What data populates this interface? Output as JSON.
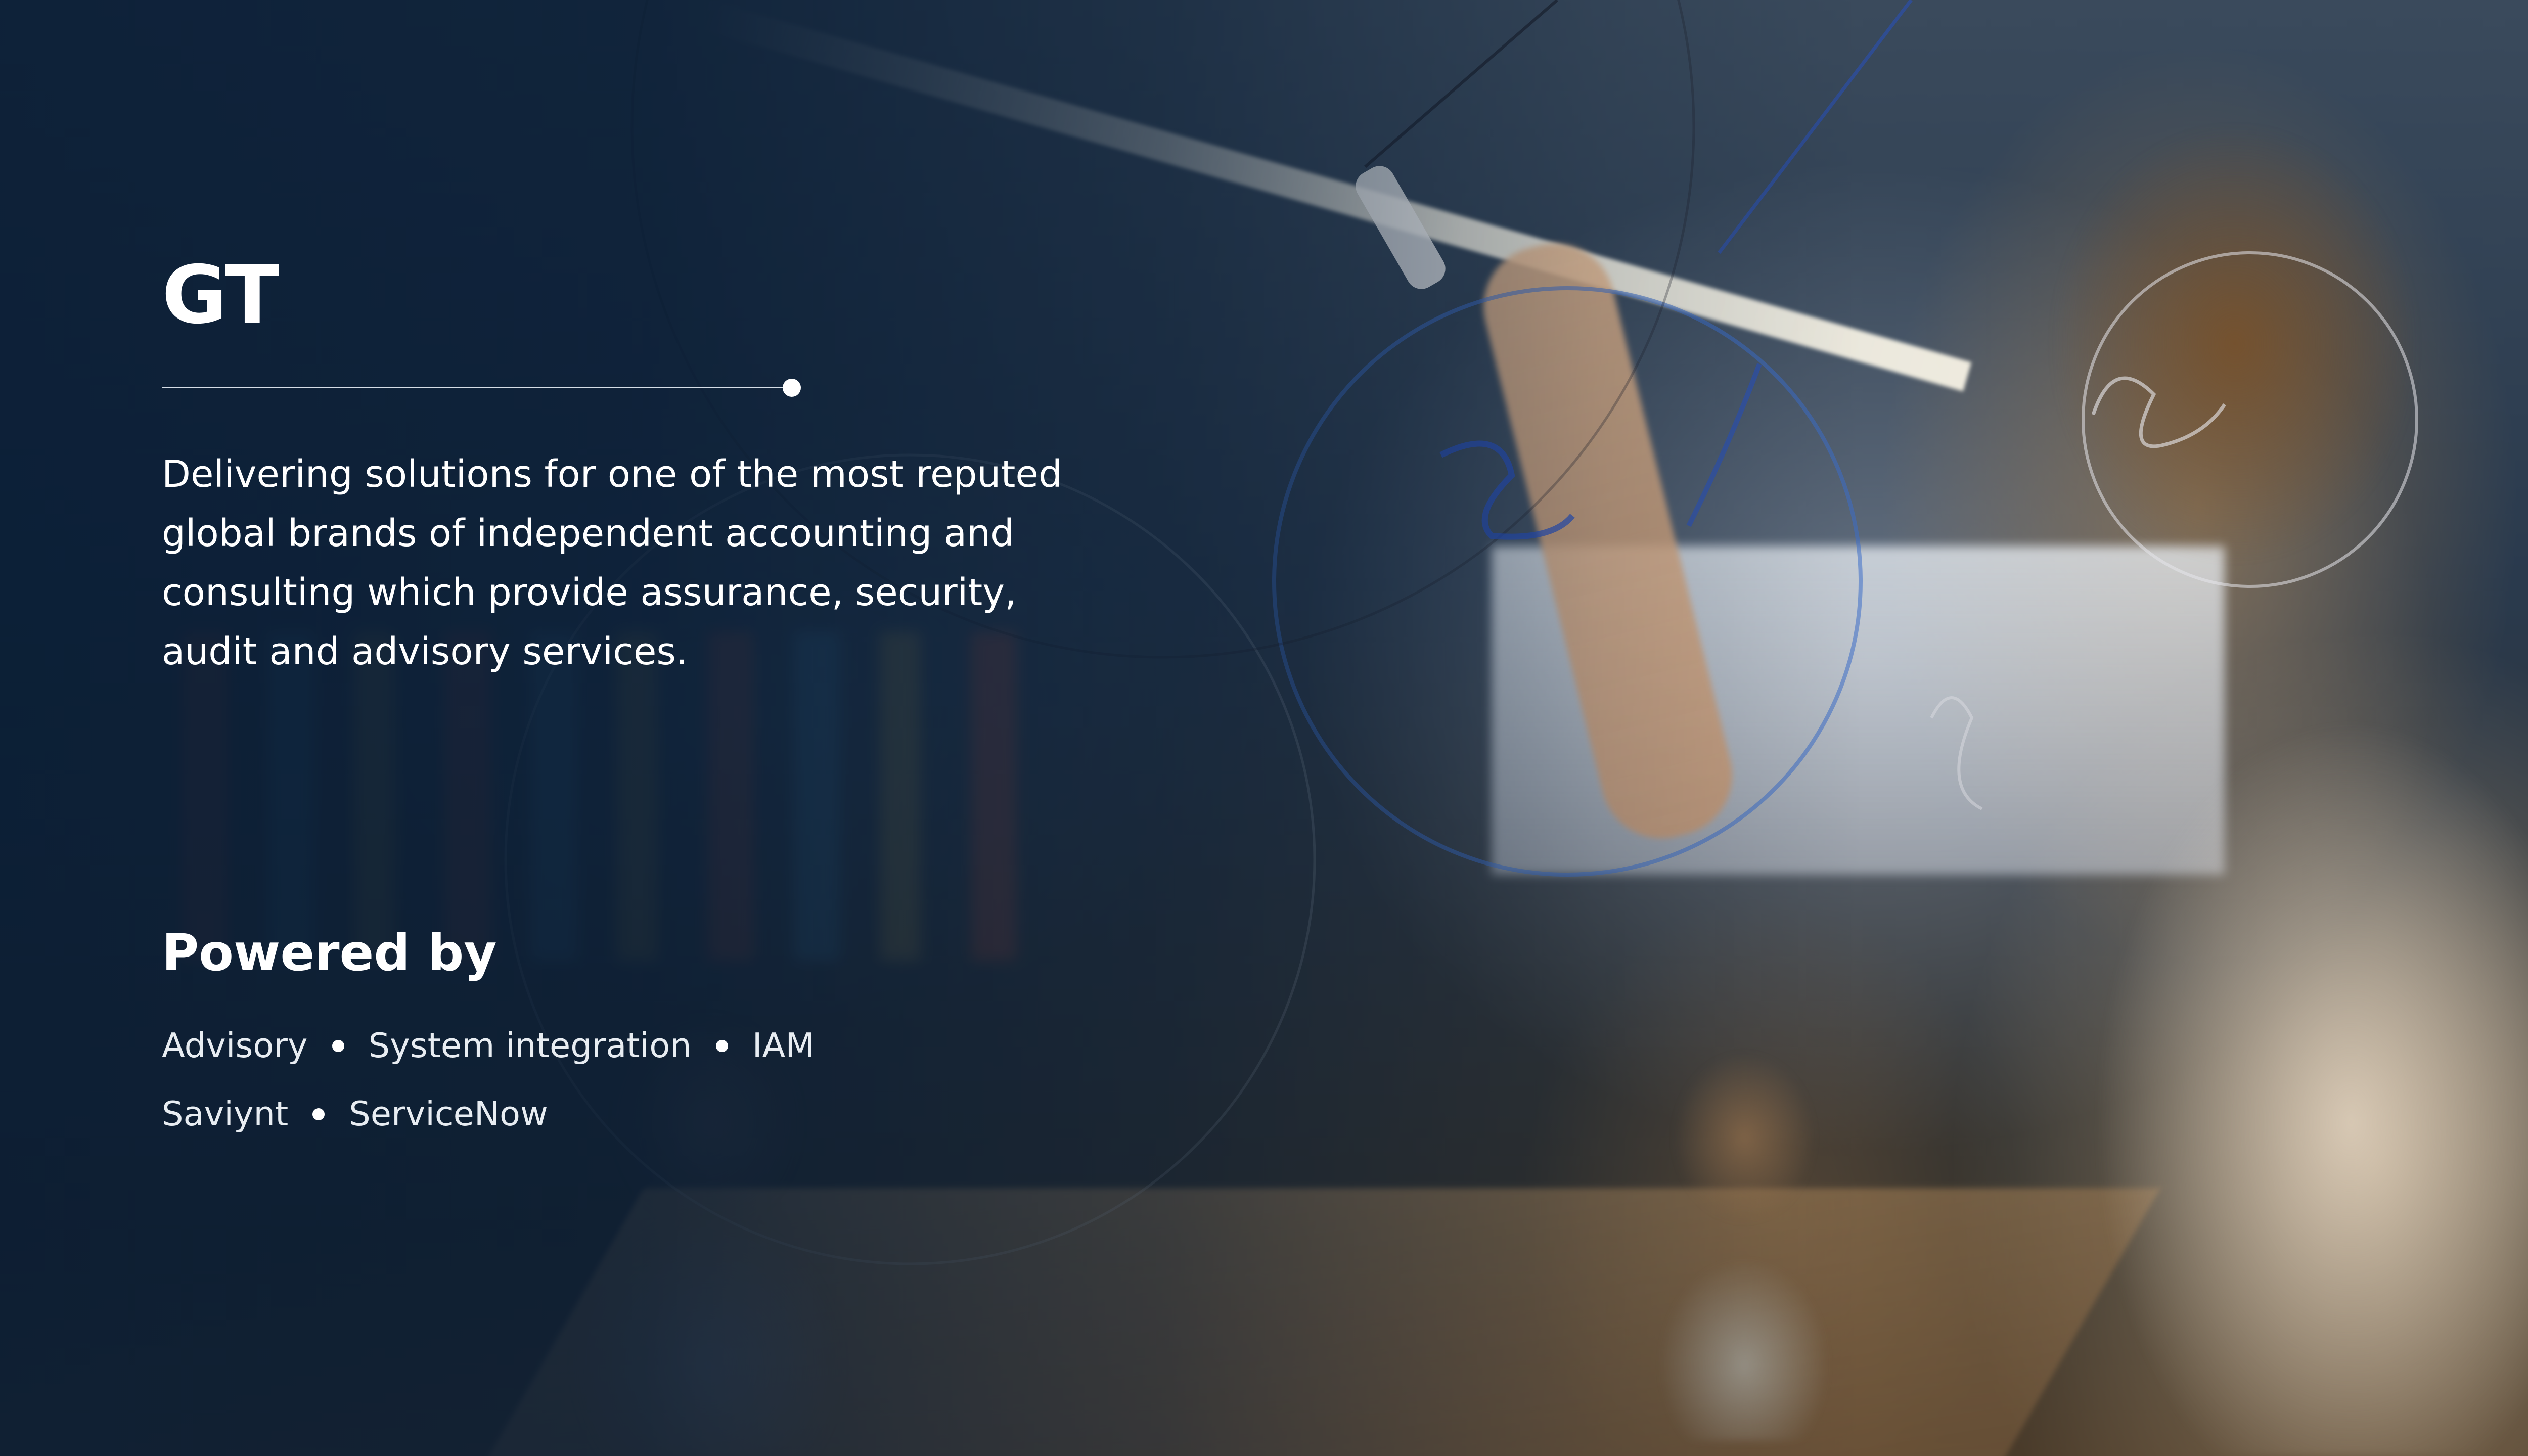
{
  "brand": {
    "title": "GT"
  },
  "description": "Delivering solutions for one of the most reputed global brands of independent accounting and consulting which provide assurance, security, audit and advisory services.",
  "powered_by": {
    "heading": "Powered by",
    "row1": [
      "Advisory",
      "System integration",
      "IAM"
    ],
    "row2": [
      "Saviynt",
      "ServiceNow"
    ]
  },
  "colors": {
    "overlay": "#081c34",
    "text": "#ffffff",
    "rule": "#d5dde6"
  },
  "background": {
    "subject": "woman-writing-on-glass-board-photo"
  }
}
